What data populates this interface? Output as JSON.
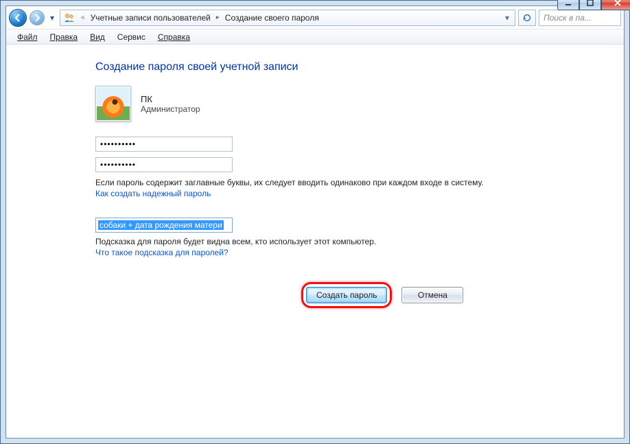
{
  "breadcrumb": {
    "root": "Учетные записи пользователей",
    "current": "Создание своего пароля"
  },
  "search": {
    "placeholder": "Поиск в па..."
  },
  "menu": {
    "file": "Файл",
    "edit": "Правка",
    "view": "Вид",
    "tools": "Сервис",
    "help": "Справка"
  },
  "page": {
    "heading": "Создание пароля своей учетной записи",
    "user_name": "ПК",
    "user_role": "Администратор",
    "password_value": "••••••••••",
    "password_confirm_value": "••••••••••",
    "caps_warning": "Если пароль содержит заглавные буквы, их следует вводить одинаково при каждом входе в систему.",
    "strong_pw_link": "Как создать надежный пароль",
    "hint_value": "собаки + дата рождения матери",
    "hint_visibility": "Подсказка для пароля будет видна всем, кто использует этот компьютер.",
    "hint_help_link": "Что такое подсказка для паролей?",
    "create_button": "Создать пароль",
    "cancel_button": "Отмена"
  }
}
